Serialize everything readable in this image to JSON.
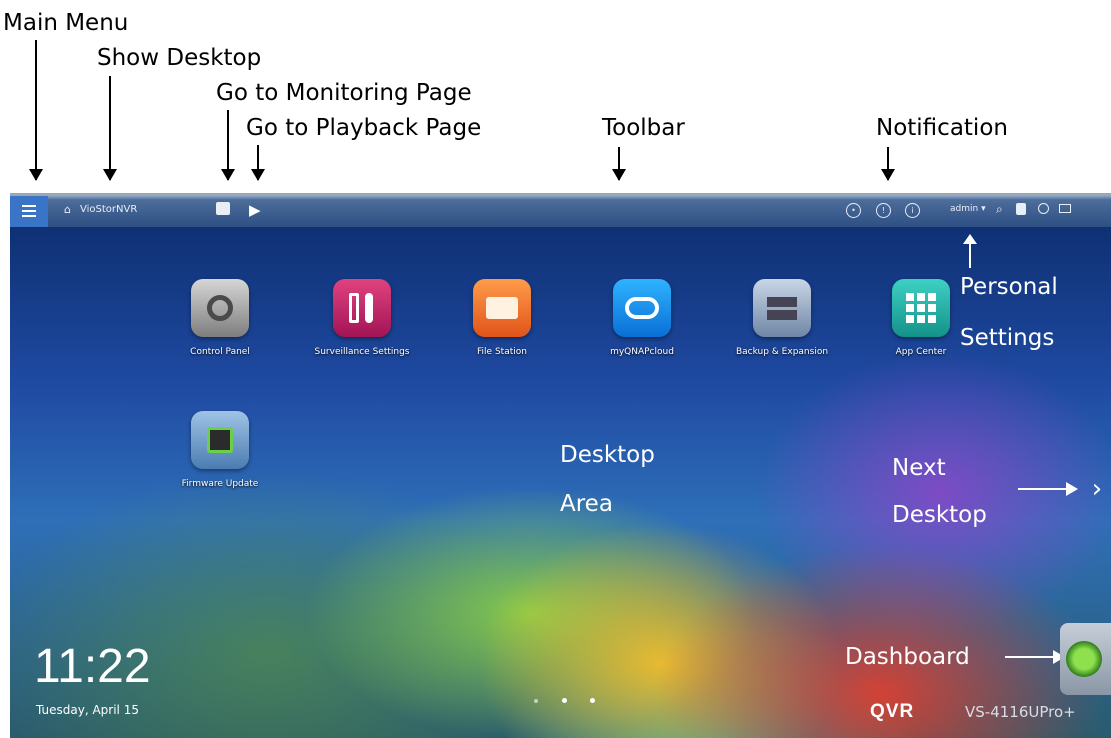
{
  "annotations": {
    "main_menu": "Main Menu",
    "show_desktop": "Show Desktop",
    "monitoring": "Go to Monitoring Page",
    "playback": "Go to Playback Page",
    "toolbar": "Toolbar",
    "notification": "Notification",
    "personal_settings_1": "Personal",
    "personal_settings_2": "Settings",
    "desktop_area_1": "Desktop",
    "desktop_area_2": "Area",
    "next_desktop_1": "Next",
    "next_desktop_2": "Desktop",
    "dashboard": "Dashboard"
  },
  "toolbar": {
    "home_label": "VioStorNVR",
    "user": "admin"
  },
  "apps": [
    {
      "label": "Control Panel"
    },
    {
      "label": "Surveillance Settings"
    },
    {
      "label": "File Station"
    },
    {
      "label": "myQNAPcloud"
    },
    {
      "label": "Backup & Expansion"
    },
    {
      "label": "App Center"
    },
    {
      "label": "Firmware Update"
    }
  ],
  "clock": {
    "time": "11:22",
    "date": "Tuesday, April 15"
  },
  "brand": {
    "logo": "QVR",
    "model": "VS-4116UPro+"
  },
  "colors": {
    "toolbar": "#2d4f83",
    "menu_button": "#3a74c6"
  }
}
